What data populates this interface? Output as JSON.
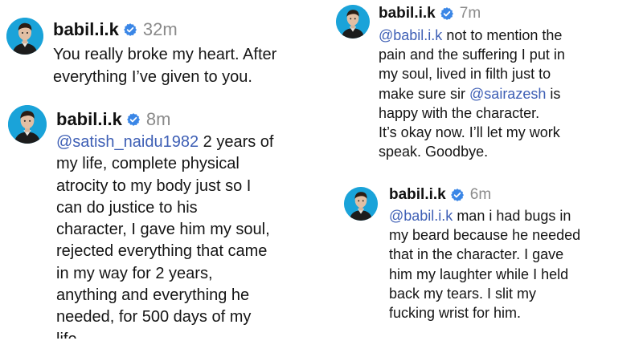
{
  "colors": {
    "avatar_bg": "#1aa3d9",
    "verified": "#3a86e6",
    "mention": "#3e5fb5",
    "timestamp": "#8a8a8a"
  },
  "comments": [
    {
      "username": "babil.i.k",
      "time": "32m",
      "lines": [
        [
          {
            "text": "You really broke my heart. After"
          }
        ],
        [
          {
            "text": "everything I’ve given to you."
          }
        ]
      ]
    },
    {
      "username": "babil.i.k",
      "time": "8m",
      "lines": [
        [
          {
            "text": "@satish_naidu1982",
            "mention": true
          },
          {
            "text": " 2 years of"
          }
        ],
        [
          {
            "text": "my life, complete physical"
          }
        ],
        [
          {
            "text": "atrocity to my body just so I"
          }
        ],
        [
          {
            "text": "can do justice to his"
          }
        ],
        [
          {
            "text": "character, I gave him my soul,"
          }
        ],
        [
          {
            "text": "rejected everything that came"
          }
        ],
        [
          {
            "text": "in my way for 2 years,"
          }
        ],
        [
          {
            "text": "anything and everything he"
          }
        ],
        [
          {
            "text": "needed, for 500 days of my"
          }
        ],
        [
          {
            "text": "life"
          }
        ]
      ]
    },
    {
      "username": "babil.i.k",
      "time": "7m",
      "lines": [
        [
          {
            "text": "@babil.i.k",
            "mention": true
          },
          {
            "text": " not to mention the"
          }
        ],
        [
          {
            "text": "pain and the suffering I put in"
          }
        ],
        [
          {
            "text": "my soul, lived in filth just to"
          }
        ],
        [
          {
            "text": "make sure sir "
          },
          {
            "text": "@sairazesh",
            "mention": true
          },
          {
            "text": " is"
          }
        ],
        [
          {
            "text": "happy with the character."
          }
        ],
        [
          {
            "text": "It’s okay now. I’ll let my work"
          }
        ],
        [
          {
            "text": "speak. Goodbye."
          }
        ]
      ]
    },
    {
      "username": "babil.i.k",
      "time": "6m",
      "lines": [
        [
          {
            "text": "@babil.i.k",
            "mention": true
          },
          {
            "text": " man i had bugs in"
          }
        ],
        [
          {
            "text": "my beard because he needed"
          }
        ],
        [
          {
            "text": "that in the character. I gave"
          }
        ],
        [
          {
            "text": "him my laughter while I held"
          }
        ],
        [
          {
            "text": "back my tears. I slit my"
          }
        ],
        [
          {
            "text": "fucking wrist for him."
          }
        ]
      ]
    }
  ]
}
